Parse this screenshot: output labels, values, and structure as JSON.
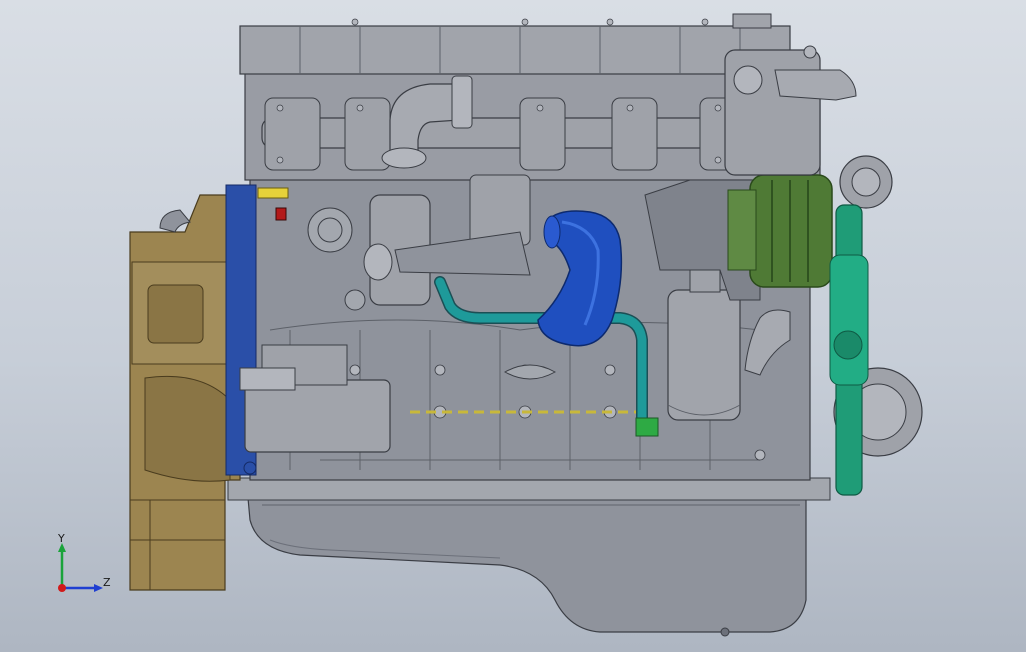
{
  "triad": {
    "y_label": "Y",
    "z_label": "Z",
    "y_color": "#1aa33a",
    "z_color": "#1f3fd1",
    "x_color": "#d11a1a"
  },
  "colors": {
    "block": "#8f939c",
    "block_dark": "#6c707a",
    "block_light": "#b3b6bd",
    "bellhousing": "#9c8550",
    "bellhousing_dark": "#7d6a3d",
    "turbo_hose": "#1f4fbf",
    "coolant_pipe": "#1e9a9a",
    "alternator": "#4f7a35",
    "pulley_green": "#1f9c77",
    "flange_blue": "#2a4fa8",
    "warning_red": "#b31a1a",
    "tag_yellow": "#e6d23a"
  }
}
